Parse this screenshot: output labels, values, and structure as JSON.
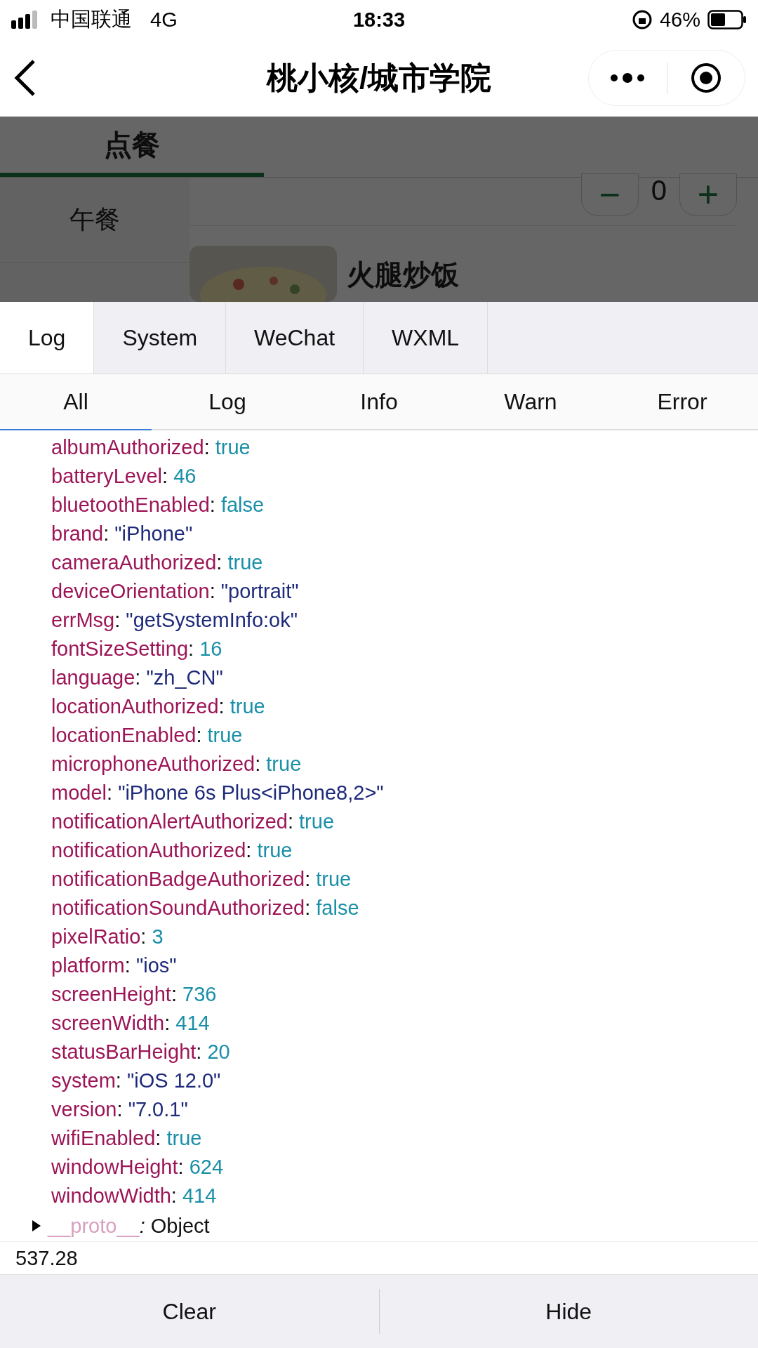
{
  "status_bar": {
    "carrier": "中国联通",
    "network": "4G",
    "time": "18:33",
    "battery": "46%"
  },
  "nav": {
    "title": "桃小核/城市学院"
  },
  "page": {
    "tabs": [
      {
        "label": "点餐",
        "selected": true
      }
    ],
    "sidebar": [
      {
        "label": "午餐"
      }
    ],
    "counter": {
      "value": "0",
      "minus": "−",
      "plus": "+"
    },
    "dish": {
      "name": "火腿炒饭"
    }
  },
  "console": {
    "tabs": [
      {
        "label": "Log",
        "selected": true
      },
      {
        "label": "System",
        "selected": false
      },
      {
        "label": "WeChat",
        "selected": false
      },
      {
        "label": "WXML",
        "selected": false
      }
    ],
    "filters": [
      {
        "label": "All",
        "selected": true
      },
      {
        "label": "Log",
        "selected": false
      },
      {
        "label": "Info",
        "selected": false
      },
      {
        "label": "Warn",
        "selected": false
      },
      {
        "label": "Error",
        "selected": false
      }
    ],
    "entries": [
      {
        "key": "albumAuthorized",
        "sep": ":",
        "value": "true",
        "kind": "literal"
      },
      {
        "key": "batteryLevel",
        "sep": ":",
        "value": "46",
        "kind": "literal"
      },
      {
        "key": "bluetoothEnabled",
        "sep": ":",
        "value": "false",
        "kind": "literal"
      },
      {
        "key": "brand",
        "sep": ":",
        "value": "\"iPhone\"",
        "kind": "string"
      },
      {
        "key": "cameraAuthorized",
        "sep": ":",
        "value": "true",
        "kind": "literal"
      },
      {
        "key": "deviceOrientation",
        "sep": ":",
        "value": "\"portrait\"",
        "kind": "string"
      },
      {
        "key": "errMsg",
        "sep": ":",
        "value": "\"getSystemInfo:ok\"",
        "kind": "string"
      },
      {
        "key": "fontSizeSetting",
        "sep": ":",
        "value": "16",
        "kind": "literal"
      },
      {
        "key": "language",
        "sep": ":",
        "value": "\"zh_CN\"",
        "kind": "string"
      },
      {
        "key": "locationAuthorized",
        "sep": ":",
        "value": "true",
        "kind": "literal"
      },
      {
        "key": "locationEnabled",
        "sep": ":",
        "value": "true",
        "kind": "literal"
      },
      {
        "key": "microphoneAuthorized",
        "sep": ":",
        "value": "true",
        "kind": "literal"
      },
      {
        "key": "model",
        "sep": ":",
        "value": "\"iPhone 6s Plus<iPhone8,2>\"",
        "kind": "string"
      },
      {
        "key": "notificationAlertAuthorized",
        "sep": ":",
        "value": "true",
        "kind": "literal"
      },
      {
        "key": "notificationAuthorized",
        "sep": ":",
        "value": "true",
        "kind": "literal"
      },
      {
        "key": "notificationBadgeAuthorized",
        "sep": ":",
        "value": "true",
        "kind": "literal"
      },
      {
        "key": "notificationSoundAuthorized",
        "sep": ":",
        "value": "false",
        "kind": "literal"
      },
      {
        "key": "pixelRatio",
        "sep": ":",
        "value": "3",
        "kind": "literal"
      },
      {
        "key": "platform",
        "sep": ":",
        "value": "\"ios\"",
        "kind": "string"
      },
      {
        "key": "screenHeight",
        "sep": ":",
        "value": "736",
        "kind": "literal"
      },
      {
        "key": "screenWidth",
        "sep": ":",
        "value": "414",
        "kind": "literal"
      },
      {
        "key": "statusBarHeight",
        "sep": ":",
        "value": "20",
        "kind": "literal"
      },
      {
        "key": "system",
        "sep": ":",
        "value": "\"iOS 12.0\"",
        "kind": "string"
      },
      {
        "key": "version",
        "sep": ":",
        "value": "\"7.0.1\"",
        "kind": "string"
      },
      {
        "key": "wifiEnabled",
        "sep": ":",
        "value": "true",
        "kind": "literal"
      },
      {
        "key": "windowHeight",
        "sep": ":",
        "value": "624",
        "kind": "literal"
      },
      {
        "key": "windowWidth",
        "sep": ":",
        "value": "414",
        "kind": "literal"
      }
    ],
    "proto": {
      "key": "__proto__",
      "sep": ":",
      "value": "Object",
      "expanded": false
    },
    "next_entry": "537.28",
    "buttons": [
      "Clear",
      "Hide"
    ]
  }
}
